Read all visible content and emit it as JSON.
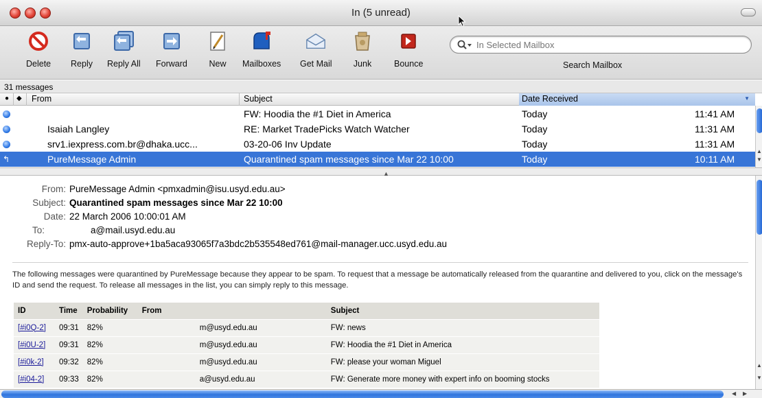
{
  "window": {
    "title": "In (5 unread)"
  },
  "toolbar": {
    "buttons": [
      {
        "label": "Delete",
        "icon": "delete-icon"
      },
      {
        "label": "Reply",
        "icon": "reply-icon"
      },
      {
        "label": "Reply All",
        "icon": "reply-all-icon"
      },
      {
        "label": "Forward",
        "icon": "forward-icon"
      },
      {
        "label": "New",
        "icon": "new-message-icon"
      },
      {
        "label": "Mailboxes",
        "icon": "mailboxes-icon"
      },
      {
        "label": "Get Mail",
        "icon": "get-mail-icon"
      },
      {
        "label": "Junk",
        "icon": "junk-icon"
      },
      {
        "label": "Bounce",
        "icon": "bounce-icon"
      }
    ],
    "search_placeholder": "In Selected Mailbox",
    "search_label": "Search Mailbox"
  },
  "status": {
    "message_count": "31 messages"
  },
  "list": {
    "headers": {
      "from": "From",
      "subject": "Subject",
      "date": "Date Received"
    },
    "rows": [
      {
        "from": "",
        "subject": "FW: Hoodia the #1 Diet in America",
        "date": "Today",
        "time": "11:41 AM",
        "unread": true,
        "selected": false
      },
      {
        "from": "Isaiah Langley",
        "subject": "RE: Market TradePicks Watch Watcher",
        "date": "Today",
        "time": "11:31 AM",
        "unread": true,
        "selected": false
      },
      {
        "from": "srv1.iexpress.com.br@dhaka.ucc...",
        "subject": "03-20-06 Inv Update",
        "date": "Today",
        "time": "11:31 AM",
        "unread": true,
        "selected": false
      },
      {
        "from": "PureMessage Admin",
        "subject": "Quarantined spam messages since Mar 22 10:00",
        "date": "Today",
        "time": "10:11 AM",
        "unread": false,
        "selected": true
      }
    ]
  },
  "message": {
    "from_key": "From:",
    "from": "PureMessage Admin <pmxadmin@isu.usyd.edu.au>",
    "subject_key": "Subject:",
    "subject": "Quarantined spam messages since Mar 22 10:00",
    "date_key": "Date:",
    "date": "22 March 2006 10:00:01 AM",
    "to_key": "To:",
    "to": "a@mail.usyd.edu.au",
    "replyto_key": "Reply-To:",
    "replyto": "pmx-auto-approve+1ba5aca93065f7a3bdc2b535548ed761@mail-manager.ucc.usyd.edu.au",
    "intro": "The following messages were quarantined by PureMessage because they appear to be spam. To request that a message be automatically released from the quarantine and delivered to you, click on the message's ID and send the request. To release all messages in the list, you can simply reply to this message.",
    "table": {
      "headers": [
        "ID",
        "Time",
        "Probability",
        "From",
        "Subject"
      ],
      "rows": [
        {
          "id": "[#i0Q-2]",
          "time": "09:31",
          "prob": "82%",
          "from": "m@usyd.edu.au",
          "subject": "FW: news"
        },
        {
          "id": "[#i0U-2]",
          "time": "09:31",
          "prob": "82%",
          "from": "m@usyd.edu.au",
          "subject": "FW: Hoodia the #1 Diet in America"
        },
        {
          "id": "[#i0k-2]",
          "time": "09:32",
          "prob": "82%",
          "from": "m@usyd.edu.au",
          "subject": "FW: please your woman Miguel"
        },
        {
          "id": "[#i04-2]",
          "time": "09:33",
          "prob": "82%",
          "from": "a@usyd.edu.au",
          "subject": "FW: Generate more money with expert info on booming stocks"
        }
      ]
    }
  }
}
